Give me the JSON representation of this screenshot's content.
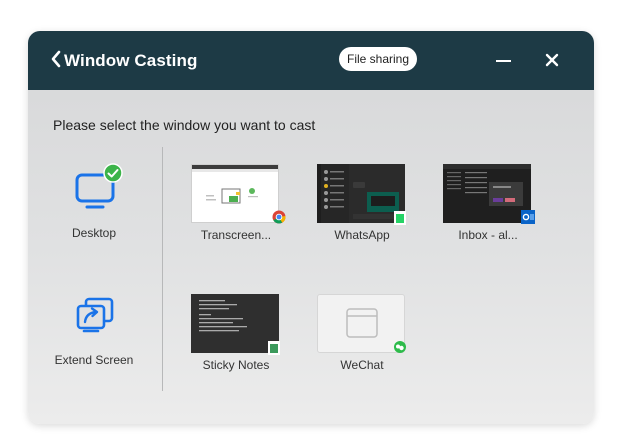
{
  "header": {
    "title": "Window Casting",
    "file_sharing_label": "File sharing"
  },
  "prompt": "Please select the window you want to cast",
  "modes": [
    {
      "label": "Desktop",
      "icon": "monitor-icon",
      "selected": true
    },
    {
      "label": "Extend Screen",
      "icon": "extend-screen-icon",
      "selected": false
    }
  ],
  "windows": [
    {
      "label": "Transcreen...",
      "app_icon": "chrome-icon"
    },
    {
      "label": "WhatsApp",
      "app_icon": "whatsapp-icon"
    },
    {
      "label": "Inbox - al...",
      "app_icon": "outlook-icon"
    },
    {
      "label": "Sticky Notes",
      "app_icon": "sticky-notes-icon"
    },
    {
      "label": "WeChat",
      "app_icon": "wechat-icon"
    }
  ],
  "colors": {
    "header_bg": "#1d3a45",
    "accent_blue": "#1a73e8",
    "check_green": "#3cb44a"
  }
}
